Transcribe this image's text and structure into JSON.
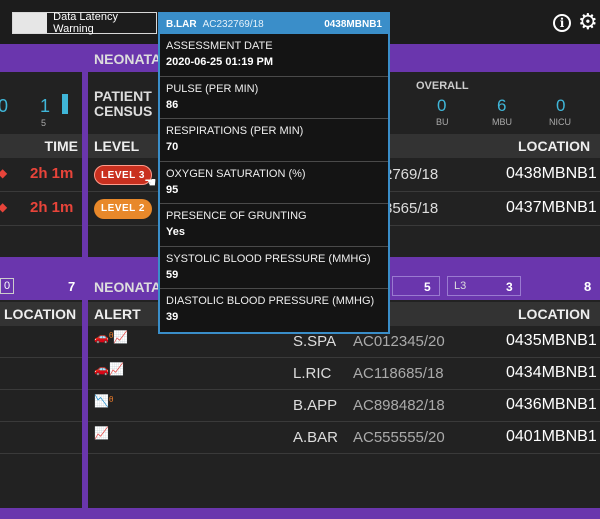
{
  "topbar": {
    "latency_label": "Data Latency Warning",
    "info_icon": "info-icon",
    "gear_icon": "gear-icon"
  },
  "left_top": {
    "counts": [
      "0",
      "1"
    ],
    "sub_count": "5",
    "time_header": "TIME",
    "rows": [
      {
        "time": "2h 1m"
      },
      {
        "time": "2h 1m"
      }
    ]
  },
  "census": {
    "title": "NEONATA",
    "label_line1": "PATIENT",
    "label_line2": "CENSUS",
    "overall": "OVERALL",
    "units": [
      {
        "count": "0",
        "name": "BU"
      },
      {
        "count": "6",
        "name": "MBU"
      },
      {
        "count": "0",
        "name": "NICU"
      }
    ],
    "level_header": "LEVEL",
    "location_header": "LOCATION",
    "rows": [
      {
        "level": "LEVEL 3",
        "id_tail": "2769/18",
        "location": "0438MBNB1"
      },
      {
        "level": "LEVEL 2",
        "id_tail": "3565/18",
        "location": "0437MBNB1"
      }
    ]
  },
  "left_bottom": {
    "count_a": "0",
    "count_b": "7",
    "location_header": "LOCATION"
  },
  "alerts": {
    "title": "NEONATA",
    "tabs": [
      {
        "label": "",
        "count": "5"
      },
      {
        "label": "L3",
        "count": "3"
      }
    ],
    "total": "8",
    "alert_header": "ALERT",
    "location_header": "LOCATION",
    "rows": [
      {
        "name": "S.SPA",
        "id": "AC012345/20",
        "location": "0435MBNB1"
      },
      {
        "name": "L.RIC",
        "id": "AC118685/18",
        "location": "0434MBNB1"
      },
      {
        "name": "B.APP",
        "id": "AC898482/18",
        "location": "0436MBNB1"
      },
      {
        "name": "A.BAR",
        "id": "AC555555/20",
        "location": "0401MBNB1"
      }
    ]
  },
  "popup": {
    "patient": "B.LAR",
    "id": "AC232769/18",
    "location": "0438MBNB1",
    "items": [
      {
        "label": "ASSESSMENT DATE",
        "value": "2020-06-25 01:19 PM"
      },
      {
        "label": "PULSE (PER MIN)",
        "value": "86"
      },
      {
        "label": "RESPIRATIONS (PER MIN)",
        "value": "70"
      },
      {
        "label": "OXYGEN SATURATION (%)",
        "value": "95"
      },
      {
        "label": "PRESENCE OF GRUNTING",
        "value": "Yes"
      },
      {
        "label": "SYSTOLIC BLOOD PRESSURE (MMHG)",
        "value": "59"
      },
      {
        "label": "DIASTOLIC BLOOD PRESSURE (MMHG)",
        "value": "39"
      }
    ]
  },
  "colors": {
    "purple": "#6a36ad",
    "accent_blue": "#3a8ec9",
    "alert_red": "#e8443a",
    "level2_orange": "#e8882a"
  }
}
